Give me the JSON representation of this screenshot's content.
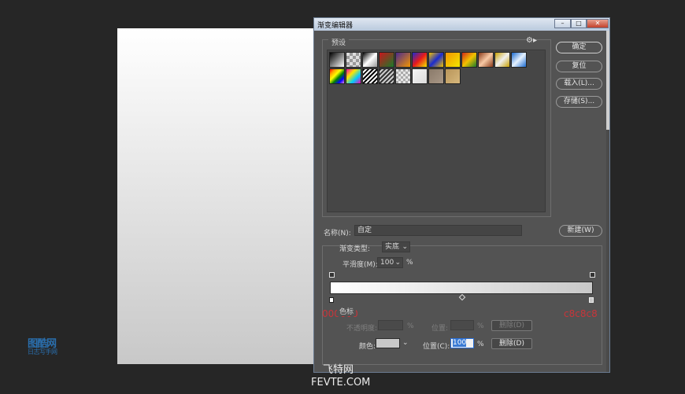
{
  "logo": {
    "line1": "图酷网",
    "line2": "日志写手网"
  },
  "dialog": {
    "title": "渐变编辑器",
    "presets_label": "预设",
    "buttons": {
      "ok": "确定",
      "reset": "复位",
      "load": "载入(L)...",
      "save": "存储(S)...",
      "new": "新建(W)"
    },
    "name_label": "名称(N):",
    "name_value": "自定",
    "gradient_type_label": "渐变类型:",
    "gradient_type_value": "实底",
    "smoothness_label": "平滑度(M):",
    "smoothness_value": "100",
    "percent": "%",
    "stops_label": "色标",
    "opacity_label": "不透明度:",
    "location_label_disabled": "位置:",
    "delete_label": "删除(D)",
    "color_label": "颜色:",
    "location_label": "位置(C):",
    "location_value": "100",
    "overlay_left": "000000",
    "overlay_right": "c8c8c8"
  },
  "watermark": {
    "cn": "飞特网",
    "en": "FEVTE.COM"
  },
  "colors": {
    "left_stop": "#ffffff",
    "right_stop": "#c8c8c8"
  }
}
